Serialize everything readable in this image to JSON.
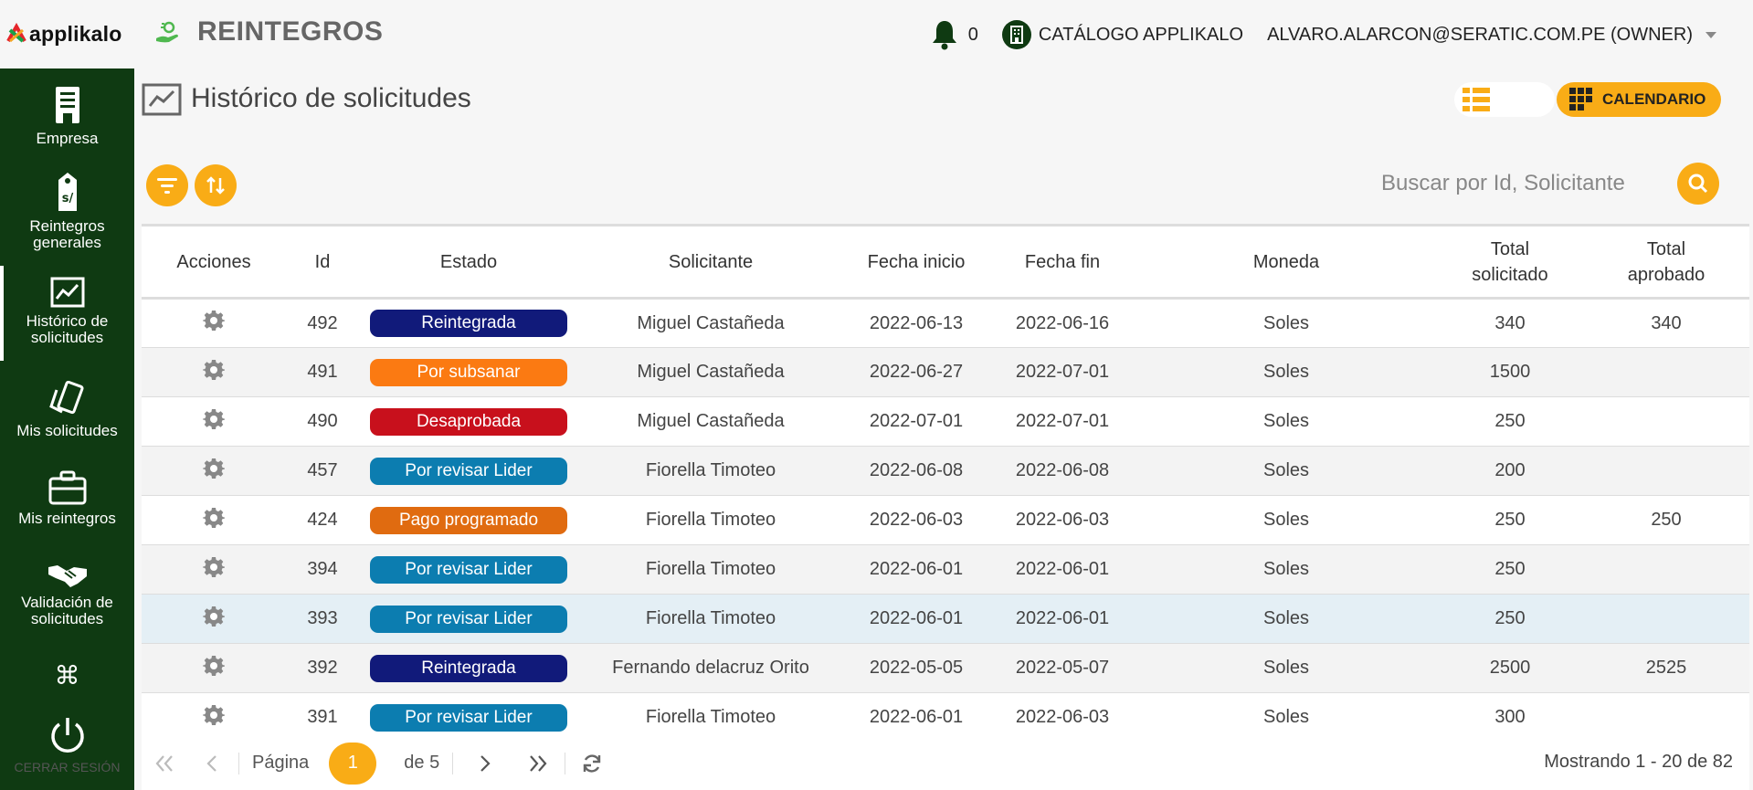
{
  "app": {
    "logo": "applikalo",
    "module_title": "REINTEGROS"
  },
  "header": {
    "notification_count": "0",
    "catalog_label": "CATÁLOGO APPLIKALO",
    "user_label": "ALVARO.ALARCON@SERATIC.COM.PE (OWNER)"
  },
  "sidebar": {
    "items": [
      {
        "label_lines": [
          "Empresa"
        ],
        "icon": "building-icon"
      },
      {
        "label_lines": [
          "Reintegros",
          "generales"
        ],
        "icon": "price-tag-icon"
      },
      {
        "label_lines": [
          "Histórico de",
          "solicitudes"
        ],
        "icon": "chart-icon"
      },
      {
        "label_lines": [
          "Mis solicitudes"
        ],
        "icon": "cards-icon"
      },
      {
        "label_lines": [
          "Mis reintegros"
        ],
        "icon": "briefcase-icon"
      },
      {
        "label_lines": [
          "Validación de",
          "solicitudes"
        ],
        "icon": "handshake-icon"
      },
      {
        "label_lines": [
          ""
        ],
        "icon": "command-icon"
      }
    ],
    "logout_label": "CERRAR SESIÓN"
  },
  "page": {
    "title": "Histórico de solicitudes",
    "calendar_label": "CALENDARIO",
    "search_placeholder": "Buscar por Id, Solicitante"
  },
  "table": {
    "headers": [
      "Acciones",
      "Id",
      "Estado",
      "Solicitante",
      "Fecha inicio",
      "Fecha fin",
      "Moneda",
      "Total solicitado",
      "Total aprobado"
    ],
    "rows": [
      {
        "id": "492",
        "estado": "Reintegrada",
        "solicitante": "Miguel Castañeda",
        "inicio": "2022-06-13",
        "fin": "2022-06-16",
        "moneda": "Soles",
        "solicitado": "340",
        "aprobado": "340"
      },
      {
        "id": "491",
        "estado": "Por subsanar",
        "solicitante": "Miguel Castañeda",
        "inicio": "2022-06-27",
        "fin": "2022-07-01",
        "moneda": "Soles",
        "solicitado": "1500",
        "aprobado": ""
      },
      {
        "id": "490",
        "estado": "Desaprobada",
        "solicitante": "Miguel Castañeda",
        "inicio": "2022-07-01",
        "fin": "2022-07-01",
        "moneda": "Soles",
        "solicitado": "250",
        "aprobado": ""
      },
      {
        "id": "457",
        "estado": "Por revisar Lider",
        "solicitante": "Fiorella Timoteo",
        "inicio": "2022-06-08",
        "fin": "2022-06-08",
        "moneda": "Soles",
        "solicitado": "200",
        "aprobado": ""
      },
      {
        "id": "424",
        "estado": "Pago programado",
        "solicitante": "Fiorella Timoteo",
        "inicio": "2022-06-03",
        "fin": "2022-06-03",
        "moneda": "Soles",
        "solicitado": "250",
        "aprobado": "250"
      },
      {
        "id": "394",
        "estado": "Por revisar Lider",
        "solicitante": "Fiorella Timoteo",
        "inicio": "2022-06-01",
        "fin": "2022-06-01",
        "moneda": "Soles",
        "solicitado": "250",
        "aprobado": ""
      },
      {
        "id": "393",
        "estado": "Por revisar Lider",
        "solicitante": "Fiorella Timoteo",
        "inicio": "2022-06-01",
        "fin": "2022-06-01",
        "moneda": "Soles",
        "solicitado": "250",
        "aprobado": ""
      },
      {
        "id": "392",
        "estado": "Reintegrada",
        "solicitante": "Fernando delacruz Orito",
        "inicio": "2022-05-05",
        "fin": "2022-05-07",
        "moneda": "Soles",
        "solicitado": "2500",
        "aprobado": "2525"
      },
      {
        "id": "391",
        "estado": "Por revisar Lider",
        "solicitante": "Fiorella Timoteo",
        "inicio": "2022-06-01",
        "fin": "2022-06-03",
        "moneda": "Soles",
        "solicitado": "300",
        "aprobado": ""
      }
    ]
  },
  "status_colors": {
    "Reintegrada": "#111a7a",
    "Por subsanar": "#fb7a12",
    "Desaprobada": "#c8101c",
    "Por revisar Lider": "#0c7db0",
    "Pago programado": "#e06b10"
  },
  "pager": {
    "page_label": "Página",
    "current_page": "1",
    "of_label": "de 5",
    "showing": "Mostrando 1 - 20 de 82"
  },
  "colors": {
    "sidebar_bg": "#0f3a12",
    "accent": "#f9ac16"
  }
}
